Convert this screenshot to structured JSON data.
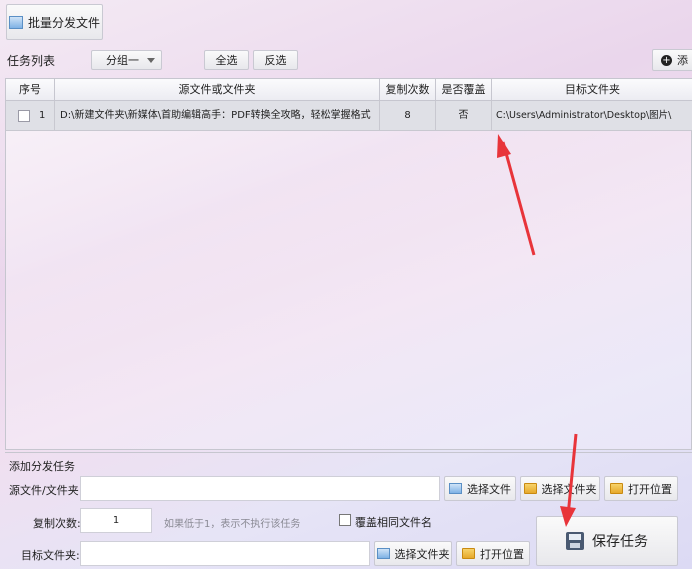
{
  "toolbar": {
    "batch_label": "批量分发文件"
  },
  "tasklist": {
    "label": "任务列表",
    "group_value": "分组一",
    "select_all": "全选",
    "invert": "反选",
    "add_label": "添"
  },
  "table": {
    "headers": [
      "序号",
      "源文件或文件夹",
      "复制次数",
      "是否覆盖",
      "目标文件夹"
    ],
    "rows": [
      {
        "index": "1",
        "source": "D:\\新建文件夹\\新媒体\\首助编辑高手：PDF转换全攻略，轻松掌握格式",
        "copies": "8",
        "overwrite": "否",
        "target": "C:\\Users\\Administrator\\Desktop\\图片\\"
      }
    ]
  },
  "form": {
    "section_title": "添加分发任务",
    "source_label": "源文件/文件夹:",
    "select_file": "选择文件",
    "select_folder": "选择文件夹",
    "open_location": "打开位置",
    "copies_label": "复制次数:",
    "copies_value": "1",
    "copies_hint": "如果低于1，表示不执行该任务",
    "overwrite_label": "覆盖相同文件名",
    "target_label": "目标文件夹:",
    "target_select_folder": "选择文件夹",
    "target_open_location": "打开位置",
    "save_task": "保存任务"
  },
  "colors": {
    "arrow": "#e8343a",
    "row_bg": "#dfe0e6"
  }
}
